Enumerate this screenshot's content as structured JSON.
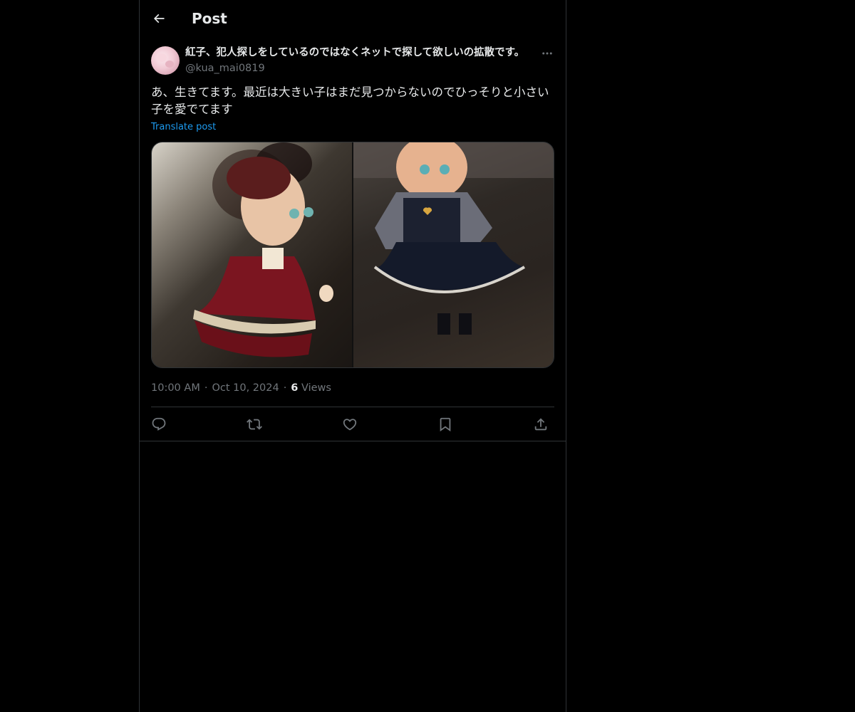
{
  "header": {
    "title": "Post",
    "back_icon": "arrow-left-icon"
  },
  "post": {
    "author": {
      "display_name": "紅子、犯人探しをしているのではなくネットで探して欲しいの拡散です。",
      "handle": "@kua_mai0819"
    },
    "text": "あ、生きてます。最近は大きい子はまだ見つからないのでひっそりと小さい子を愛でてます",
    "translate_label": "Translate post",
    "time": "10:00 AM",
    "date": "Oct 10, 2024",
    "views_count": "6",
    "views_label": "Views",
    "separator": "·",
    "media_count": 2
  },
  "actions": [
    {
      "name": "reply",
      "icon": "reply-icon"
    },
    {
      "name": "repost",
      "icon": "repost-icon"
    },
    {
      "name": "like",
      "icon": "heart-icon"
    },
    {
      "name": "bookmark",
      "icon": "bookmark-icon"
    },
    {
      "name": "share",
      "icon": "share-icon"
    }
  ],
  "colors": {
    "background": "#000000",
    "text_primary": "#e7e9ea",
    "text_secondary": "#71767b",
    "accent": "#1d9bf0",
    "border": "#2f3336"
  }
}
